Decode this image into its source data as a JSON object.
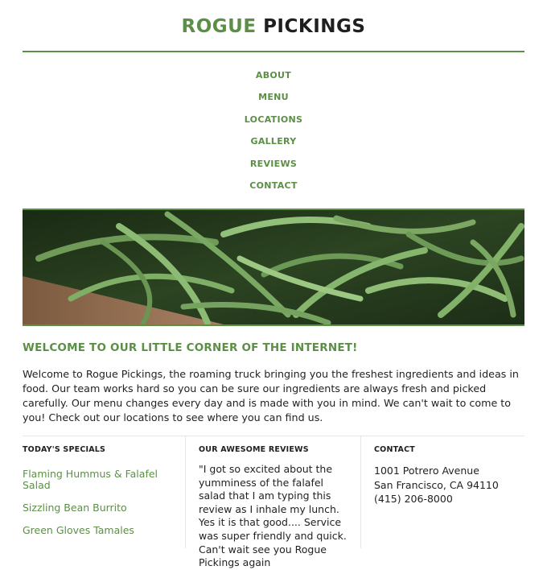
{
  "brand": {
    "first": "ROGUE",
    "second": "PICKINGS"
  },
  "colors": {
    "accent": "#5b8f46",
    "text": "#222222",
    "rule": "#e6e6e6"
  },
  "nav": {
    "items": [
      {
        "label": "ABOUT"
      },
      {
        "label": "MENU"
      },
      {
        "label": "LOCATIONS"
      },
      {
        "label": "GALLERY"
      },
      {
        "label": "REVIEWS"
      },
      {
        "label": "CONTACT"
      }
    ]
  },
  "hero": {
    "image_icon": "green-beans-photo"
  },
  "welcome": {
    "title": "WELCOME TO OUR LITTLE CORNER OF THE INTERNET!",
    "body": "Welcome to Rogue Pickings, the roaming truck bringing you the freshest ingredients and ideas in food. Our team works hard so you can be sure our ingredients are always fresh and picked carefully. Our menu changes every day and is made with you in mind. We can't wait to come to you! Check out our locations to see where you can find us."
  },
  "specials": {
    "heading": "TODAY'S SPECIALS",
    "items": [
      "Flaming Hummus & Falafel Salad",
      "Sizzling Bean Burrito",
      "Green Gloves Tamales"
    ]
  },
  "reviews": {
    "heading": "OUR AWESOME REVIEWS",
    "quote": "\"I got so excited about the yumminess of the falafel salad that I am typing this review as I inhale my lunch. Yes it is that good.... Service was super friendly and quick. Can't wait see you Rogue Pickings again"
  },
  "contact": {
    "heading": "CONTACT",
    "street": "1001 Potrero Avenue",
    "city": "San Francisco, CA 94110",
    "phone": "(415) 206-8000"
  }
}
